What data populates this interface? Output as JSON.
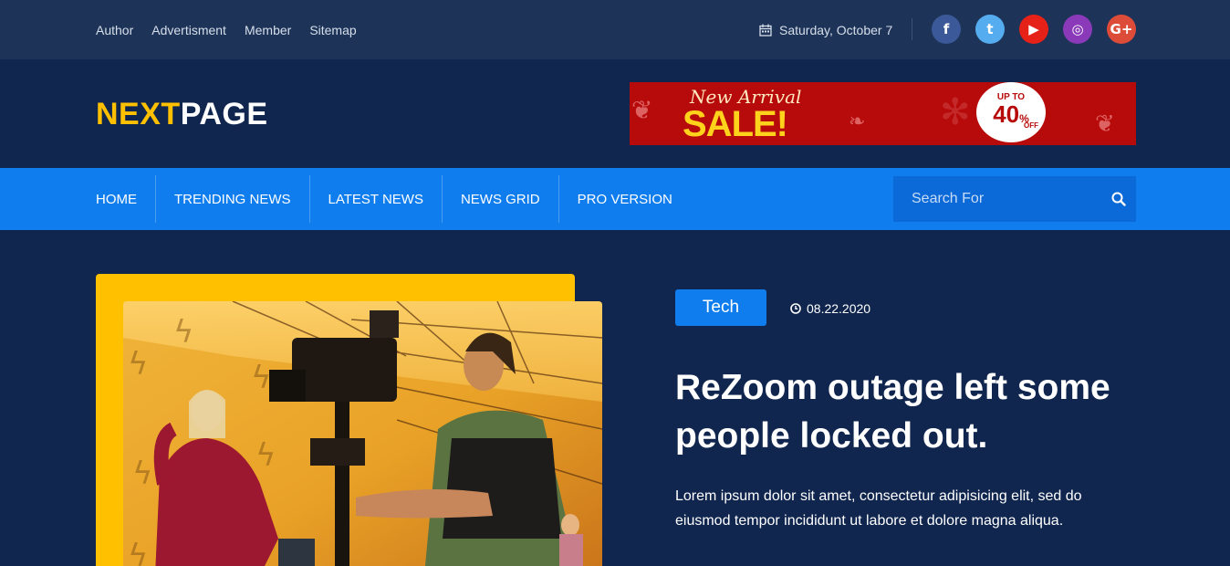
{
  "topbar": {
    "links": [
      "Author",
      "Advertisment",
      "Member",
      "Sitemap"
    ],
    "date": "Saturday, October 7",
    "date_icon": "calendar-icon",
    "social": [
      {
        "name": "facebook-icon",
        "glyph": "f",
        "color": "#3b5998"
      },
      {
        "name": "twitter-icon",
        "glyph": "t",
        "color": "#55acee"
      },
      {
        "name": "youtube-icon",
        "glyph": "▶",
        "color": "#e62117"
      },
      {
        "name": "instagram-icon",
        "glyph": "◎",
        "color": "#8a3ab9"
      },
      {
        "name": "google-plus-icon",
        "glyph": "G+",
        "color": "#dd4b39"
      }
    ]
  },
  "header": {
    "logo_part1": "NEXT",
    "logo_part2": "PAGE",
    "banner": {
      "arrival": "New Arrival",
      "sale": "SALE!",
      "upto": "UP TO",
      "percent": "40",
      "percent_sign": "%",
      "off": "OFF"
    }
  },
  "nav": {
    "items": [
      "HOME",
      "TRENDING NEWS",
      "LATEST NEWS",
      "NEWS GRID",
      "PRO VERSION"
    ],
    "search_placeholder": "Search For"
  },
  "hero": {
    "tag": "Tech",
    "date": "08.22.2020",
    "title": "ReZoom outage left some people locked out.",
    "excerpt": "Lorem ipsum dolor sit amet, consectetur adipisicing elit, sed do eiusmod tempor incididunt ut labore et dolore magna aliqua."
  },
  "colors": {
    "accent_yellow": "#ffc000",
    "accent_blue": "#0f7ded",
    "background": "#10264f"
  }
}
